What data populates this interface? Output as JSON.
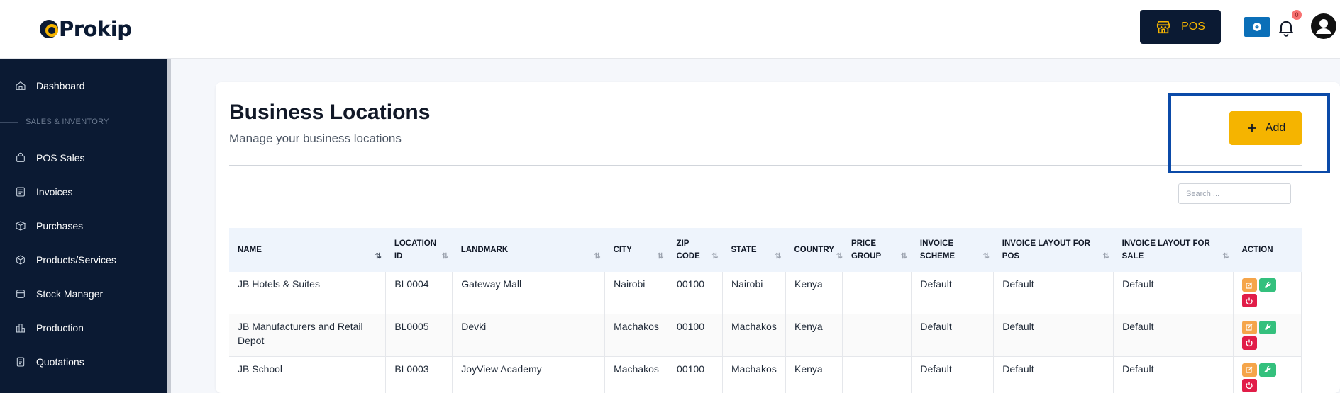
{
  "brand": {
    "name": "Prokip"
  },
  "header": {
    "pos_label": "POS",
    "notification_count": "0"
  },
  "sidebar": {
    "section_label": "SALES & INVENTORY",
    "items": [
      {
        "label": "Dashboard",
        "icon": "home-icon"
      },
      {
        "label": "POS Sales",
        "icon": "basket-icon"
      },
      {
        "label": "Invoices",
        "icon": "invoice-icon"
      },
      {
        "label": "Purchases",
        "icon": "box-icon"
      },
      {
        "label": "Products/Services",
        "icon": "cube-icon"
      },
      {
        "label": "Stock Manager",
        "icon": "folder-icon"
      },
      {
        "label": "Production",
        "icon": "factory-icon"
      },
      {
        "label": "Quotations",
        "icon": "quote-icon"
      }
    ]
  },
  "page": {
    "title": "Business Locations",
    "subtitle": "Manage your business locations",
    "add_label": "Add",
    "search_placeholder": "Search ..."
  },
  "table": {
    "columns": [
      [
        "NAME"
      ],
      [
        "LOCATION",
        "ID"
      ],
      [
        "LANDMARK"
      ],
      [
        "CITY"
      ],
      [
        "ZIP",
        "CODE"
      ],
      [
        "STATE"
      ],
      [
        "COUNTRY"
      ],
      [
        "PRICE",
        "GROUP"
      ],
      [
        "INVOICE",
        "SCHEME"
      ],
      [
        "INVOICE LAYOUT FOR",
        "POS"
      ],
      [
        "INVOICE LAYOUT FOR",
        "SALE"
      ],
      [
        "ACTION"
      ]
    ],
    "rows": [
      [
        "JB Hotels & Suites",
        "BL0004",
        "Gateway Mall",
        "Nairobi",
        "00100",
        "Nairobi",
        "Kenya",
        "",
        "Default",
        "Default",
        "Default"
      ],
      [
        "JB Manufacturers and Retail Depot",
        "BL0005",
        "Devki",
        "Machakos",
        "00100",
        "Machakos",
        "Kenya",
        "",
        "Default",
        "Default",
        "Default"
      ],
      [
        "JB School",
        "BL0003",
        "JoyView Academy",
        "Machakos",
        "00100",
        "Machakos",
        "Kenya",
        "",
        "Default",
        "Default",
        "Default"
      ]
    ]
  },
  "colors": {
    "navy": "#0b1a33",
    "accent": "#f5b400",
    "highlight": "#0b4aa8"
  }
}
